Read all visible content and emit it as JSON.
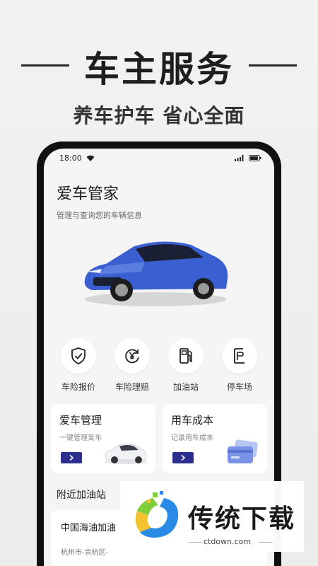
{
  "promo": {
    "title": "车主服务",
    "subtitle": "养车护车  省心全面"
  },
  "status_bar": {
    "time": "18:00",
    "icons": [
      "wifi-icon",
      "signal-icon",
      "battery-icon"
    ]
  },
  "header": {
    "title": "爱车管家",
    "description": "管理与查询您的车辆信息"
  },
  "quick_actions": [
    {
      "label": "车险报价",
      "icon": "shield-check-icon"
    },
    {
      "label": "车险理赔",
      "icon": "yen-refund-icon"
    },
    {
      "label": "加油站",
      "icon": "fuel-pump-icon"
    },
    {
      "label": "停车场",
      "icon": "parking-icon"
    }
  ],
  "cards": [
    {
      "title": "爱车管理",
      "subtitle": "一键管理爱车",
      "icon": "white-car-icon"
    },
    {
      "title": "用车成本",
      "subtitle": "记录用车成本",
      "icon": "cards-icon"
    }
  ],
  "nearby": {
    "title": "附近加油站",
    "station_name": "中国海油加油",
    "station_address": "杭州市-余杭区-"
  },
  "watermark": {
    "text": "传统下载",
    "url": "ctdown.com"
  },
  "colors": {
    "accent": "#2c2f8e",
    "car_blue": "#3a5fd0"
  }
}
